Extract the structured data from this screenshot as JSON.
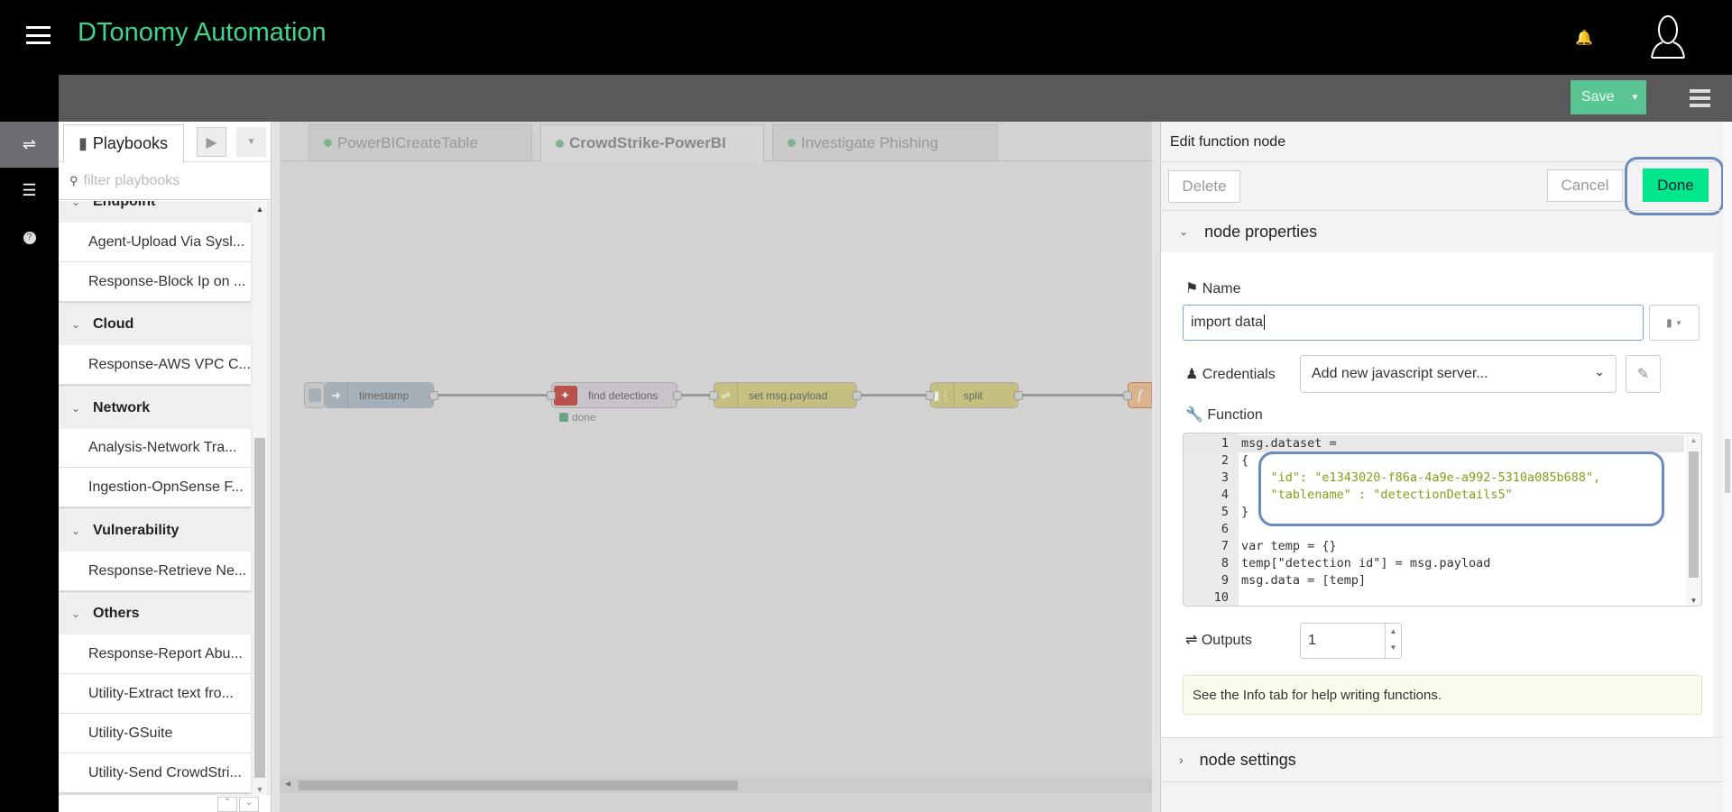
{
  "app": {
    "title": "DTonomy Automation",
    "accent": "#3dd68c",
    "menu_icon": "hamburger-icon",
    "notif_icon": "bell-icon",
    "avatar_icon": "user-icon"
  },
  "toolbar": {
    "save_label": "Save",
    "save_color": "#5ac593"
  },
  "sidebar_left": {
    "icons": [
      "shuffle-icon",
      "sliders-icon",
      "help-icon"
    ]
  },
  "playbooks": {
    "tab_label": "Playbooks",
    "filter_placeholder": "filter playbooks",
    "groups": [
      {
        "name": "Endpoint",
        "items": [
          "Agent-Upload Via Sysl...",
          "Response-Block Ip on ..."
        ]
      },
      {
        "name": "Cloud",
        "items": [
          "Response-AWS VPC C..."
        ]
      },
      {
        "name": "Network",
        "items": [
          "Analysis-Network Tra...",
          "Ingestion-OpnSense F..."
        ]
      },
      {
        "name": "Vulnerability",
        "items": [
          "Response-Retrieve Ne..."
        ]
      },
      {
        "name": "Others",
        "items": [
          "Response-Report Abu...",
          "Utility-Extract text fro...",
          "Utility-GSuite",
          "Utility-Send CrowdStri..."
        ]
      }
    ]
  },
  "canvas": {
    "tabs": [
      {
        "label": "PowerBICreateTable",
        "active": false
      },
      {
        "label": "CrowdStrike-PowerBI",
        "active": true
      },
      {
        "label": "Investigate Phishing",
        "active": false
      }
    ],
    "nodes": [
      {
        "label": "timestamp",
        "color": "#a6bbcf"
      },
      {
        "label": "find detections",
        "color": "#e2d6e6",
        "status": "done"
      },
      {
        "label": "set msg.payload",
        "color": "#e2d96e"
      },
      {
        "label": "split",
        "color": "#e2d96e"
      },
      {
        "label": "",
        "color": "#fdd0a2"
      }
    ]
  },
  "editor": {
    "title": "Edit function node",
    "delete_label": "Delete",
    "cancel_label": "Cancel",
    "done_label": "Done",
    "done_color": "#00e68a",
    "node_properties_label": "node properties",
    "name_label": "Name",
    "name_value": "import data",
    "credentials_label": "Credentials",
    "credentials_value": "Add new javascript server...",
    "function_label": "Function",
    "code_lines": [
      "msg.dataset =",
      "{",
      "    \"id\": \"e1343020-f86a-4a9e-a992-5310a085b688\",",
      "    \"tablename\" : \"detectionDetails5\"",
      "}",
      "",
      "var temp = {}",
      "temp[\"detection id\"] = msg.payload",
      "msg.data = [temp]",
      ""
    ],
    "line_numbers": [
      "1",
      "2",
      "3",
      "4",
      "5",
      "6",
      "7",
      "8",
      "9",
      "10"
    ],
    "outputs_label": "Outputs",
    "outputs_value": "1",
    "info_text": "See the Info tab for help writing functions.",
    "node_settings_label": "node settings"
  }
}
